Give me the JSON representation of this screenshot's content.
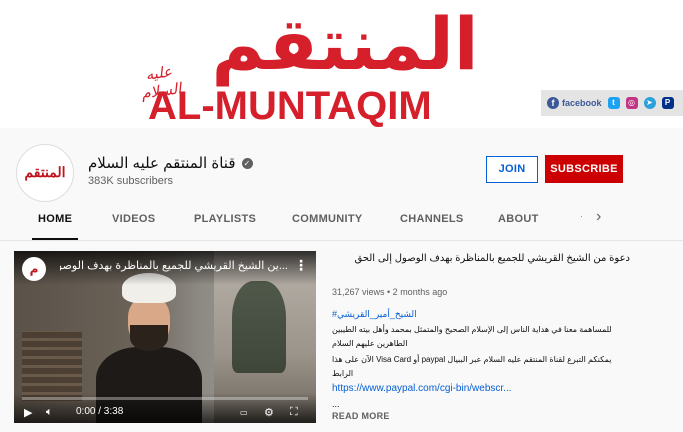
{
  "banner": {
    "logo_arabic": "المنتقم",
    "logo_swash": "عليه السلام",
    "logo_latin": "AL-MUNTAQIM",
    "social_label": "facebook",
    "colors": {
      "brand_red": "#d51f2a"
    }
  },
  "channel": {
    "avatar_glyph": "المنتقم",
    "name": "قناة المنتقم عليه السلام",
    "subscribers": "383K subscribers",
    "join_label": "JOIN",
    "subscribe_label": "SUBSCRIBE"
  },
  "tabs": [
    {
      "label": "HOME",
      "active": true
    },
    {
      "label": "VIDEOS",
      "active": false
    },
    {
      "label": "PLAYLISTS",
      "active": false
    },
    {
      "label": "COMMUNITY",
      "active": false
    },
    {
      "label": "CHANNELS",
      "active": false
    },
    {
      "label": "ABOUT",
      "active": false
    }
  ],
  "video": {
    "overlay_title": "...ين الشيخ القريشي للجميع بالمناظرة بهدف الوصول إلى الحق",
    "time": "0:00 / 3:38",
    "progress": 0
  },
  "description": {
    "title": "دعوة من الشيخ القريشي للجميع بالمناظرة بهدف الوصول إلى الحق",
    "meta": "31,267 views • 2 months ago",
    "hashtag": "#الشيخ_أمير_القريشي",
    "line1": "للمساهمة معنا في هداية الناس إلى الإسلام الصحيح والمتمثل بمحمد وأهل بيته الطيبين",
    "line2": "الطاهرين عليهم السلام",
    "line3": "يمكنكم التبرع لقناة المنتقم عليه السلام عبر الببيال paypal أو Visa Card الآن على هذا",
    "line4": "الرابط",
    "link": "https://www.paypal.com/cgi-bin/webscr...",
    "ellipsis": "...",
    "read_more": "READ MORE"
  }
}
